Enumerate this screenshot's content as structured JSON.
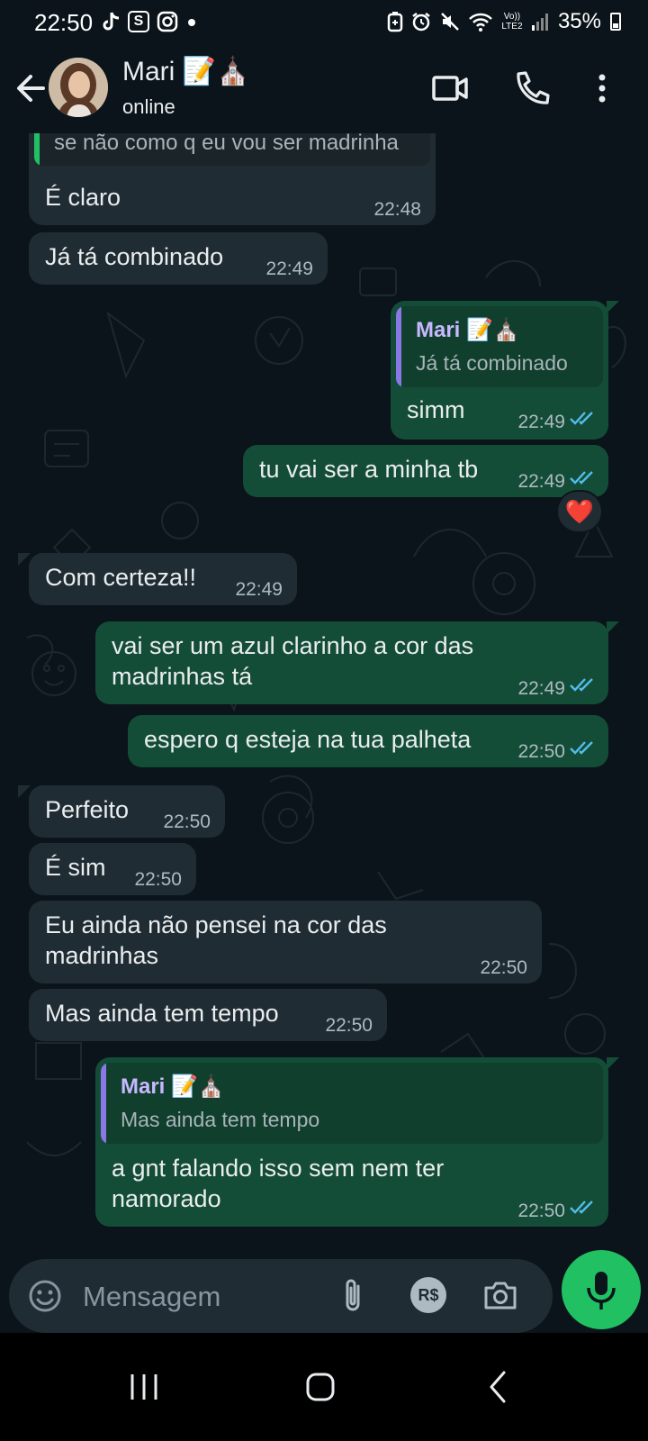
{
  "status_bar": {
    "time": "22:50",
    "left_icons": [
      "tiktok-icon",
      "s-icon",
      "instagram-icon",
      "dot-icon"
    ],
    "right_icons": [
      "battery-saver-icon",
      "alarm-icon",
      "mute-icon",
      "wifi-icon",
      "volte-icon",
      "signal-icon"
    ],
    "volte_label": "Vo)) LTE2",
    "battery": "35%"
  },
  "header": {
    "contact_name": "Mari 📝⛪",
    "contact_status": "online",
    "actions": [
      "video-call-icon",
      "voice-call-icon",
      "more-options-icon"
    ]
  },
  "messages": [
    {
      "id": "m1",
      "direction": "in",
      "quoted_partial": "se não como q eu vou ser madrinha",
      "text": "É claro",
      "time": "22:48"
    },
    {
      "id": "m2",
      "direction": "in",
      "text": "Já tá combinado",
      "time": "22:49"
    },
    {
      "id": "m3",
      "direction": "out",
      "reply_to": {
        "name": "Mari 📝⛪",
        "text": "Já tá combinado"
      },
      "text": "simm",
      "time": "22:49",
      "status": "read"
    },
    {
      "id": "m4",
      "direction": "out",
      "text": "tu vai ser a minha tb",
      "time": "22:49",
      "status": "read",
      "reaction": "❤️"
    },
    {
      "id": "m5",
      "direction": "in",
      "text": "Com certeza!!",
      "time": "22:49"
    },
    {
      "id": "m6",
      "direction": "out",
      "text_lines": [
        "vai ser um azul clarinho a cor das",
        "madrinhas tá"
      ],
      "time": "22:49",
      "status": "read"
    },
    {
      "id": "m7",
      "direction": "out",
      "text": "espero q esteja na tua palheta",
      "time": "22:50",
      "status": "read"
    },
    {
      "id": "m8",
      "direction": "in",
      "text": "Perfeito",
      "time": "22:50"
    },
    {
      "id": "m9",
      "direction": "in",
      "text": "É sim",
      "time": "22:50"
    },
    {
      "id": "m10",
      "direction": "in",
      "text_lines": [
        "Eu ainda não pensei na cor das",
        "madrinhas"
      ],
      "time": "22:50"
    },
    {
      "id": "m11",
      "direction": "in",
      "text": "Mas ainda tem tempo",
      "time": "22:50"
    },
    {
      "id": "m12",
      "direction": "out",
      "reply_to": {
        "name": "Mari 📝⛪",
        "text": "Mas ainda tem tempo"
      },
      "text_lines": [
        "a gnt falando isso sem nem ter",
        "namorado"
      ],
      "time": "22:50",
      "status": "read"
    }
  ],
  "input": {
    "placeholder": "Mensagem",
    "pay_label": "R$"
  },
  "colors": {
    "background": "#0b141a",
    "incoming_bubble": "#202c33",
    "outgoing_bubble": "#144d37",
    "read_ticks": "#53bdeb",
    "mic_button": "#21c063",
    "quote_bar": "#8b78e6"
  }
}
